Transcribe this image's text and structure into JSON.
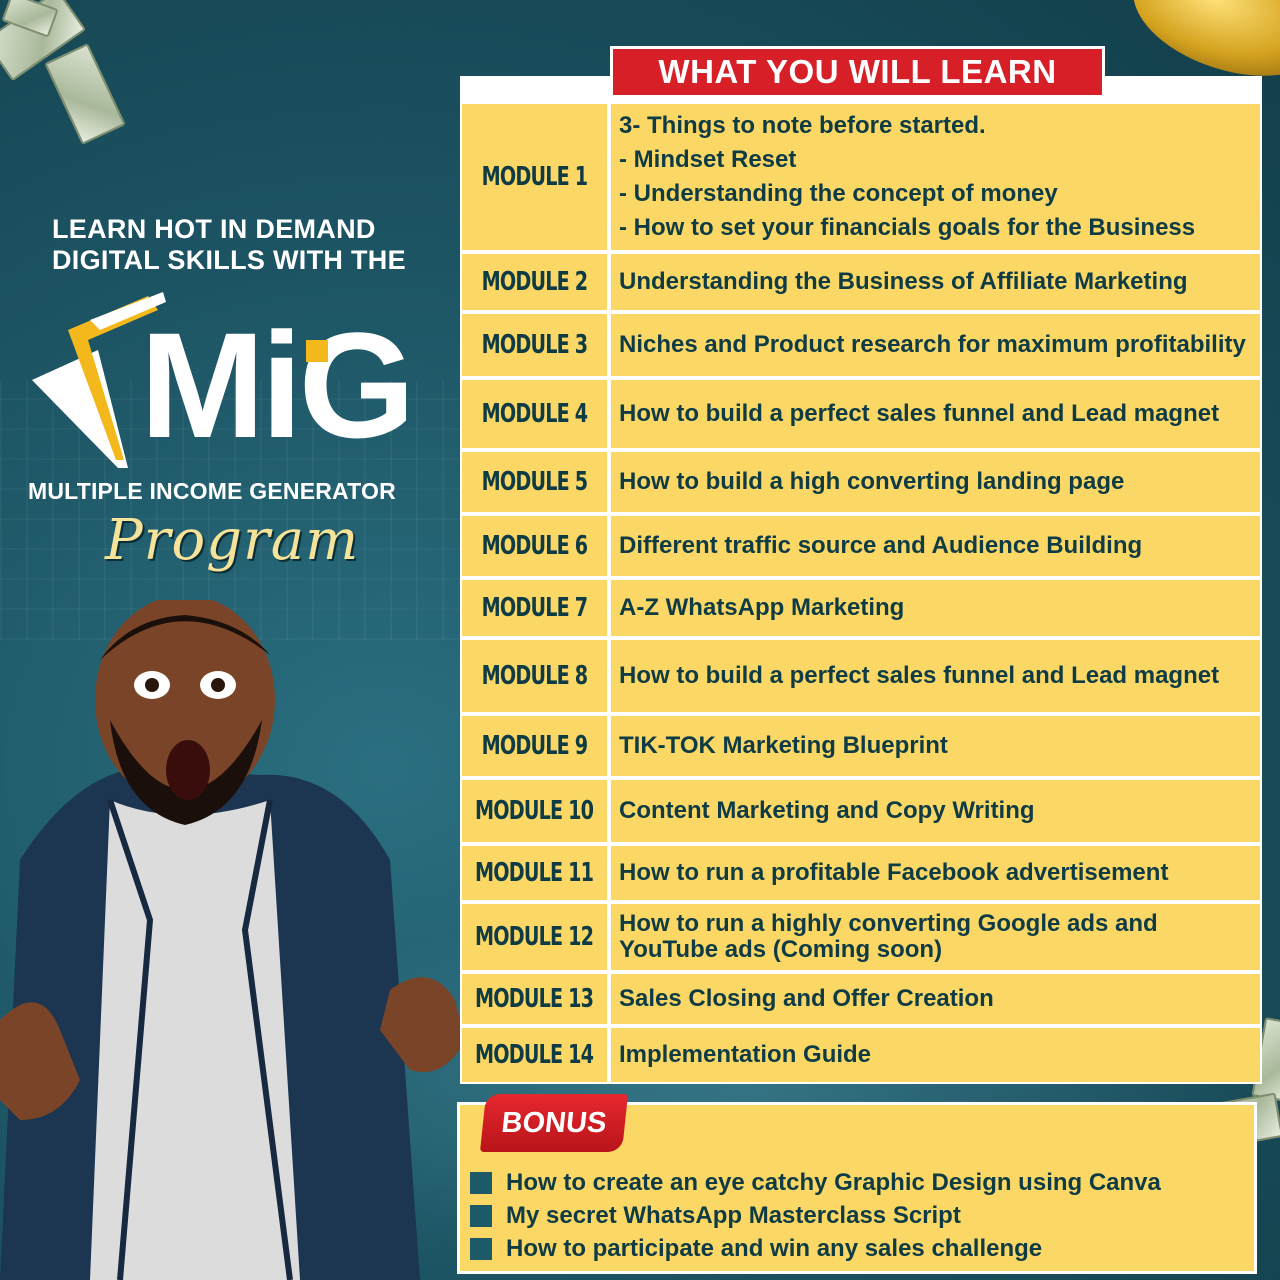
{
  "headline": {
    "line1": "LEARN HOT IN DEMAND",
    "line2": "DIGITAL SKILLS WITH THE"
  },
  "logo": {
    "wordmark": "MiG",
    "subtitle": "MULTIPLE INCOME GENERATOR",
    "script": "Program"
  },
  "table": {
    "header": "WHAT YOU WILL LEARN",
    "modules": [
      {
        "label": "MODULE 1",
        "lines": [
          "3- Things to note before started.",
          "- Mindset Reset",
          "- Understanding the concept of money",
          "- How to set your financials goals for the Business"
        ]
      },
      {
        "label": "MODULE 2",
        "text": "Understanding the Business of Affiliate Marketing"
      },
      {
        "label": "MODULE 3",
        "text": "Niches and Product research for maximum profitability"
      },
      {
        "label": "MODULE 4",
        "text": "How to build a perfect sales funnel and Lead magnet"
      },
      {
        "label": "MODULE 5",
        "text": "How to build a high converting landing page"
      },
      {
        "label": "MODULE 6",
        "text": "Different traffic source and Audience Building"
      },
      {
        "label": "MODULE 7",
        "text": "A-Z WhatsApp Marketing"
      },
      {
        "label": "MODULE 8",
        "text": "How to build a perfect sales funnel and Lead magnet"
      },
      {
        "label": "MODULE 9",
        "text": "TIK-TOK Marketing Blueprint"
      },
      {
        "label": "MODULE 10",
        "text": "Content Marketing and Copy Writing"
      },
      {
        "label": "MODULE 11",
        "text": "How to run a profitable Facebook advertisement"
      },
      {
        "label": "MODULE 12",
        "text": "How to run a highly converting Google ads and YouTube ads  (Coming soon)"
      },
      {
        "label": "MODULE 13",
        "text": "Sales Closing and Offer Creation"
      },
      {
        "label": "MODULE 14",
        "text": "Implementation Guide"
      }
    ]
  },
  "bonus": {
    "label": "BONUS",
    "items": [
      "How to create an eye catchy Graphic Design using Canva",
      "My secret WhatsApp Masterclass Script",
      "How to participate and win any sales challenge"
    ]
  },
  "colors": {
    "background": "#1d5564",
    "panel_yellow": "#fbd866",
    "banner_red": "#d61f26",
    "text_dark": "#0f3b45",
    "logo_gold": "#f3b81c"
  }
}
